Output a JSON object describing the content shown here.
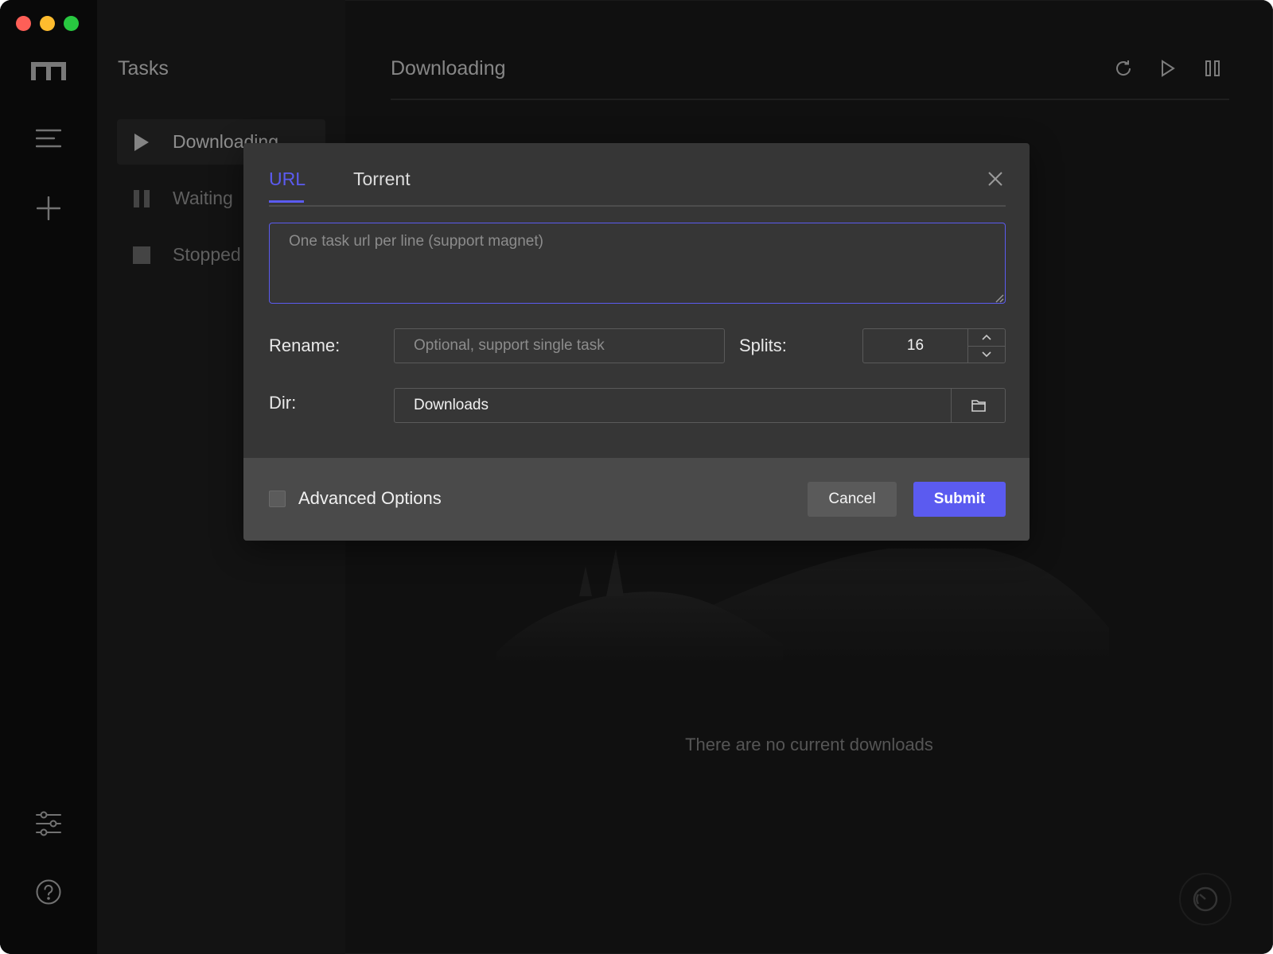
{
  "window": {
    "traffic_lights": [
      "close",
      "minimize",
      "maximize"
    ]
  },
  "rail": {
    "logo_icon": "motrix-logo-icon",
    "items": [
      {
        "icon": "menu-icon"
      },
      {
        "icon": "plus-icon"
      },
      {
        "icon": "sliders-icon"
      },
      {
        "icon": "help-circle-icon"
      }
    ]
  },
  "sidebar": {
    "title": "Tasks",
    "items": [
      {
        "label": "Downloading",
        "icon": "play-icon",
        "active": true
      },
      {
        "label": "Waiting",
        "icon": "pause-icon",
        "active": false
      },
      {
        "label": "Stopped",
        "icon": "stop-icon",
        "active": false
      }
    ]
  },
  "main": {
    "title": "Downloading",
    "toolbar": [
      "refresh-icon",
      "resume-all-icon",
      "pause-all-icon"
    ],
    "empty_text": "There are no current downloads"
  },
  "dialog": {
    "tabs": [
      {
        "label": "URL",
        "active": true
      },
      {
        "label": "Torrent",
        "active": false
      }
    ],
    "url_input": {
      "value": "",
      "placeholder": "One task url per line (support magnet)"
    },
    "rename": {
      "label": "Rename:",
      "value": "",
      "placeholder": "Optional, support single task"
    },
    "splits": {
      "label": "Splits:",
      "value": "16"
    },
    "dir": {
      "label": "Dir:",
      "value": "Downloads"
    },
    "advanced_label": "Advanced Options",
    "cancel_label": "Cancel",
    "submit_label": "Submit"
  },
  "colors": {
    "accent": "#5b5bf0",
    "rail_bg": "#0f0f0f",
    "sidebar_bg": "#1f1f1f",
    "main_bg": "#1a1a1a",
    "dialog_bg": "#363636",
    "dialog_footer_bg": "#4a4a4a"
  }
}
